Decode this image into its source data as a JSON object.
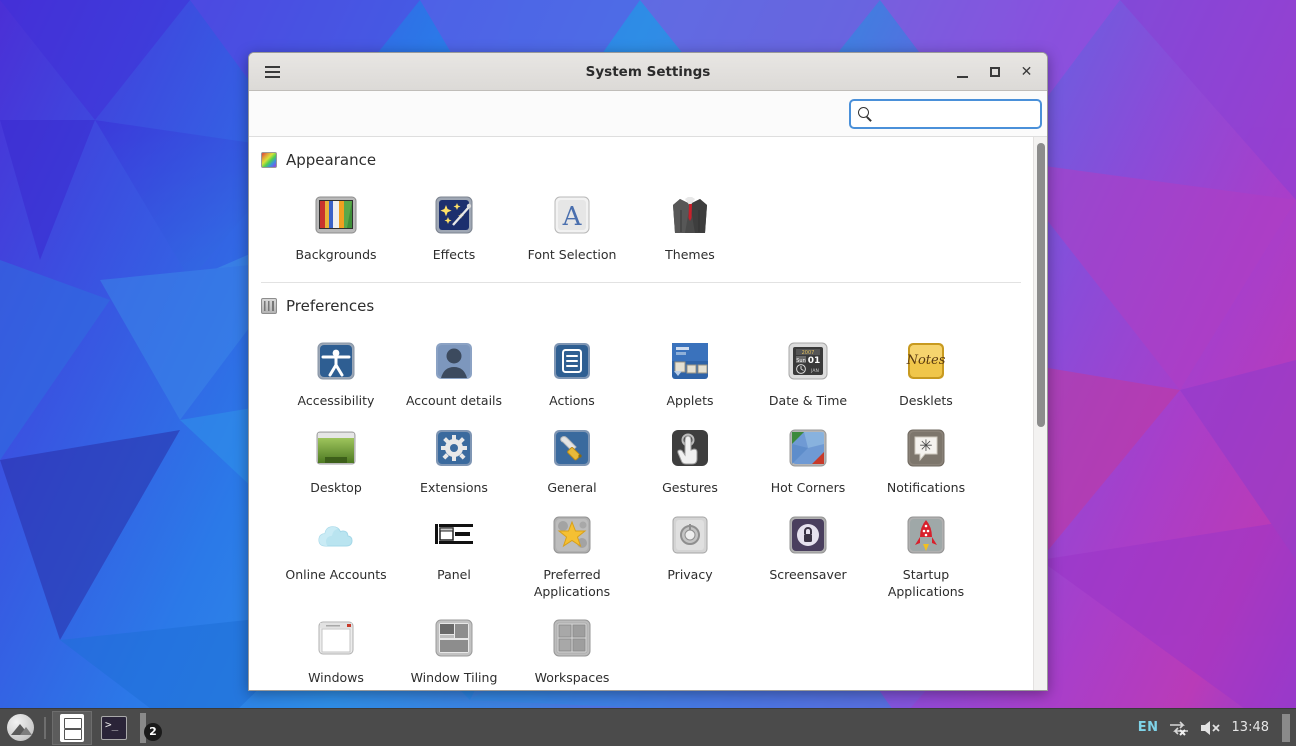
{
  "window": {
    "title": "System Settings",
    "menu_icon": "hamburger-icon",
    "minimize_label": "_",
    "maximize_label": "□",
    "close_label": "✕"
  },
  "search": {
    "value": "",
    "placeholder": "",
    "icon": "search-icon",
    "clear_icon": "clear-icon",
    "clear_label": "✕"
  },
  "sections": [
    {
      "id": "appearance",
      "title": "Appearance",
      "icon": "color-palette-icon",
      "items": [
        {
          "label": "Backgrounds",
          "icon": "backgrounds-icon"
        },
        {
          "label": "Effects",
          "icon": "effects-icon"
        },
        {
          "label": "Font Selection",
          "icon": "font-selection-icon"
        },
        {
          "label": "Themes",
          "icon": "themes-icon"
        }
      ]
    },
    {
      "id": "preferences",
      "title": "Preferences",
      "icon": "sliders-icon",
      "items": [
        {
          "label": "Accessibility",
          "icon": "accessibility-icon"
        },
        {
          "label": "Account details",
          "icon": "account-details-icon"
        },
        {
          "label": "Actions",
          "icon": "actions-icon"
        },
        {
          "label": "Applets",
          "icon": "applets-icon"
        },
        {
          "label": "Date & Time",
          "icon": "date-time-icon"
        },
        {
          "label": "Desklets",
          "icon": "desklets-icon"
        },
        {
          "label": "Desktop",
          "icon": "desktop-icon"
        },
        {
          "label": "Extensions",
          "icon": "extensions-icon"
        },
        {
          "label": "General",
          "icon": "general-icon"
        },
        {
          "label": "Gestures",
          "icon": "gestures-icon"
        },
        {
          "label": "Hot Corners",
          "icon": "hot-corners-icon"
        },
        {
          "label": "Notifications",
          "icon": "notifications-icon"
        },
        {
          "label": "Online Accounts",
          "icon": "online-accounts-icon"
        },
        {
          "label": "Panel",
          "icon": "panel-icon"
        },
        {
          "label": "Preferred Applications",
          "icon": "preferred-applications-icon"
        },
        {
          "label": "Privacy",
          "icon": "privacy-icon"
        },
        {
          "label": "Screensaver",
          "icon": "screensaver-icon"
        },
        {
          "label": "Startup Applications",
          "icon": "startup-applications-icon"
        },
        {
          "label": "Windows",
          "icon": "windows-icon"
        },
        {
          "label": "Window Tiling",
          "icon": "window-tiling-icon"
        },
        {
          "label": "Workspaces",
          "icon": "workspaces-icon"
        }
      ]
    }
  ],
  "taskbar": {
    "menu_icon": "mint-menu-icon",
    "windows": [
      {
        "name": "file-manager",
        "icon": "file-manager-icon",
        "active": true
      },
      {
        "name": "terminal",
        "icon": "terminal-icon",
        "active": false
      }
    ],
    "badge_count": "2",
    "tray": {
      "language": "EN",
      "network_icon": "network-disconnected-icon",
      "volume_icon": "volume-muted-icon",
      "clock": "13:48"
    }
  },
  "colors": {
    "accent": "#4a90d9",
    "titlebar": "#e8e6e3",
    "taskbar": "#4b4b4b",
    "text": "#2d2d2d"
  }
}
